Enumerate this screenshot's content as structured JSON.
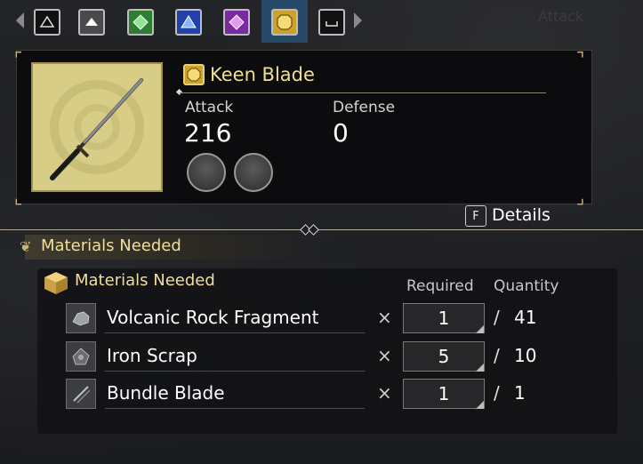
{
  "tabs": [
    {
      "icon": "triangle-outline-icon",
      "color": "#111111"
    },
    {
      "icon": "up-triangle-icon",
      "color": "#4a4a4a"
    },
    {
      "icon": "green-diamond-icon",
      "color": "#2e7d32"
    },
    {
      "icon": "blue-triangle-icon",
      "color": "#2340a8"
    },
    {
      "icon": "purple-diamond-icon",
      "color": "#7a2aa0"
    },
    {
      "icon": "gold-octagon-icon",
      "color": "#caa22c",
      "selected": true
    },
    {
      "icon": "underscore-icon",
      "color": "#111111"
    }
  ],
  "item": {
    "name": "Keen Blade",
    "attack_label": "Attack",
    "attack_value": "216",
    "defense_label": "Defense",
    "defense_value": "0",
    "details_key": "F",
    "details_label": "Details"
  },
  "materials": {
    "section_title": "Materials Needed",
    "sub_title": "Materials Needed",
    "col_required": "Required",
    "col_quantity": "Quantity",
    "rows": [
      {
        "name": "Volcanic Rock Fragment",
        "multiply": "×",
        "required": "1",
        "slash": "/",
        "have": "41",
        "icon": "rock-icon"
      },
      {
        "name": "Iron Scrap",
        "multiply": "×",
        "required": "5",
        "slash": "/",
        "have": "10",
        "icon": "iron-scrap-icon"
      },
      {
        "name": "Bundle Blade",
        "multiply": "×",
        "required": "1",
        "slash": "/",
        "have": "1",
        "icon": "bundle-blade-icon"
      }
    ]
  },
  "background_hint": {
    "attack": "Attack"
  }
}
